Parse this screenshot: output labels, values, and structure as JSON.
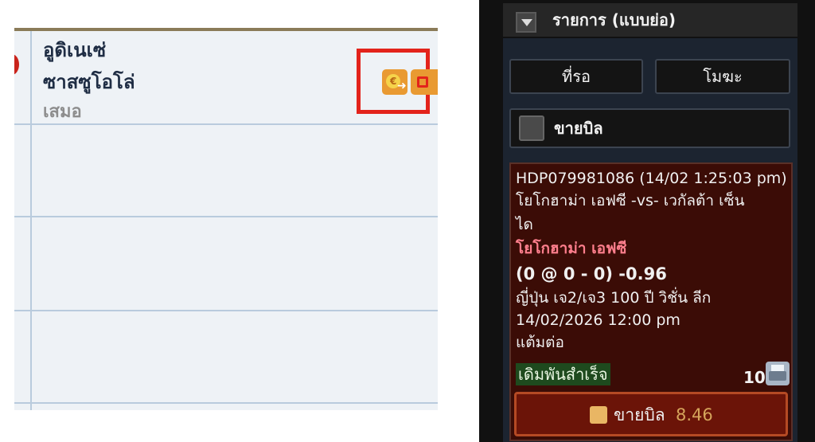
{
  "left": {
    "team_home": "อูดิเนเซ่",
    "team_away": "ซาสซูโอโล่",
    "draw_label": "เสมอ"
  },
  "right": {
    "header_title": "รายการ (แบบย่อ)",
    "tabs": [
      {
        "label": "ที่รอ"
      },
      {
        "label": "โมฆะ"
      }
    ],
    "sell_bill_label": "ขายบิล",
    "bet": {
      "id_line": "HDP079981086 (14/02 1:25:03 pm)",
      "match_line1": "โยโกฮาม่า เอฟซี -vs- เวกัลต้า เซ็น",
      "match_line2": "ได",
      "selection": "โยโกฮาม่า เอฟซี",
      "odds": "(0 @ 0 - 0)  -0.96",
      "league": "ญี่ปุ่น เจ2/เจ3 100 ปี วิชั่น ลีก",
      "kickoff": "14/02/2026 12:00 pm",
      "bet_type": "แต้มต่อ",
      "status": "เดิมพันสำเร็จ",
      "stake": "10",
      "sell_button_label": "ขายบิล",
      "sell_button_value": "8.46"
    }
  },
  "colors": {
    "highlight": "#e3231b",
    "card_bg": "#3b0c06",
    "selection": "#ff7f8d",
    "success_bg": "#1e4a1e"
  },
  "icons": [
    "cashout-icon",
    "print-icon",
    "chevron-down-icon"
  ]
}
